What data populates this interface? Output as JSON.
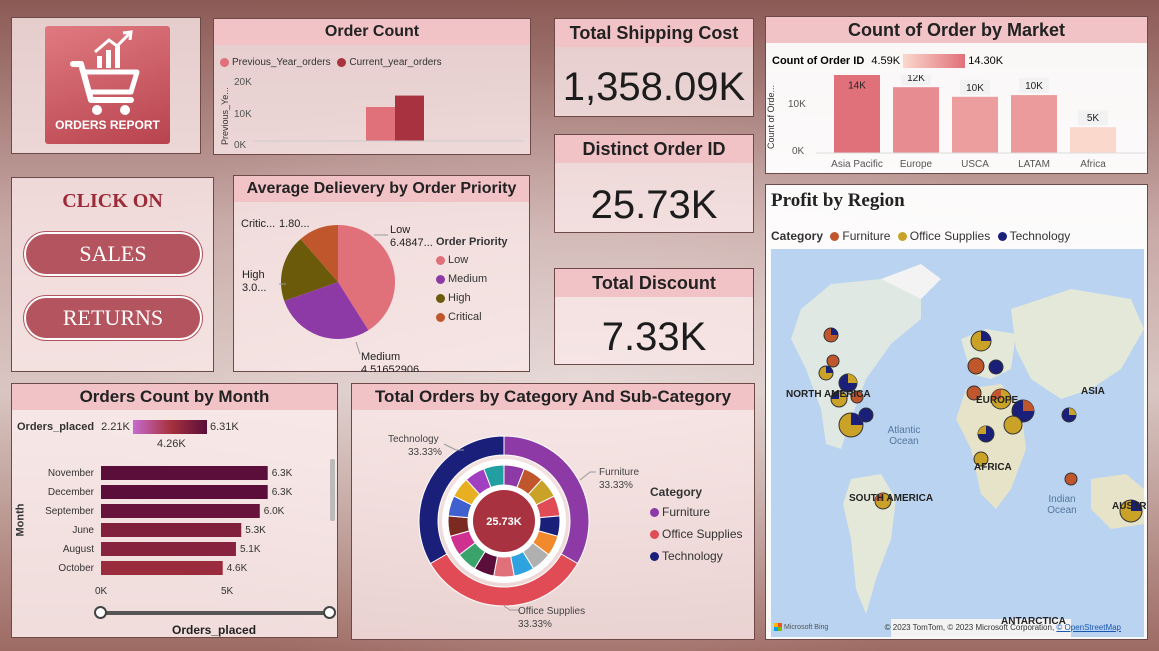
{
  "logo": {
    "label": "ORDERS REPORT"
  },
  "nav": {
    "title": "CLICK ON",
    "sales": "SALES",
    "returns": "RETURNS"
  },
  "order_count": {
    "title": "Order Count",
    "legend": [
      "Previous_Year_orders",
      "Current_year_orders"
    ],
    "ylabel": "Previous_Ye...",
    "ticks": [
      "20K",
      "10K",
      "0K"
    ],
    "colors": [
      "#e0707a",
      "#a8323f"
    ]
  },
  "shipping": {
    "title": "Total Shipping Cost",
    "value": "1,358.09K"
  },
  "distinct": {
    "title": "Distinct Order ID",
    "value": "25.73K"
  },
  "discount": {
    "title": "Total Discount",
    "value": "7.33K"
  },
  "market": {
    "title": "Count of Order by Market",
    "gradient_label": "Count of Order ID",
    "gradient_min": "4.59K",
    "gradient_max": "14.30K",
    "ylabel": "Count of Orde...",
    "ticks": [
      "10K",
      "0K"
    ]
  },
  "priority": {
    "title": "Average Delievery by Order Priority",
    "legend_title": "Order Priority",
    "labels": [
      {
        "name": "Low",
        "text1": "Low",
        "text2": "6.4847..."
      },
      {
        "name": "Medium",
        "text1": "Medium",
        "text2": "4.51652906..."
      },
      {
        "name": "High",
        "text1": "High",
        "text2": "3.0..."
      },
      {
        "name": "Critical",
        "text1": "Critic...",
        "text2": "1.80..."
      }
    ],
    "legend": [
      "Low",
      "Medium",
      "High",
      "Critical"
    ],
    "colors": [
      "#e0707a",
      "#8e3aa6",
      "#6b5a0a",
      "#c0562c"
    ]
  },
  "region": {
    "title": "Profit by Region",
    "legend_title": "Category",
    "legend": [
      "Furniture",
      "Office Supplies",
      "Technology"
    ],
    "colors": [
      "#c0562c",
      "#c9a227",
      "#1a1f7a"
    ],
    "labels": {
      "na": "NORTH AMERICA",
      "sa": "SOUTH AMERICA",
      "asia": "ASIA",
      "europe": "EUROPE",
      "africa": "AFRICA",
      "aus": "AUSTR",
      "antarctica": "ANTARCTICA",
      "atlantic": "Atlantic Ocean",
      "indian": "Indian Ocean"
    },
    "attrib": "© 2023 TomTom, © 2023 Microsoft Corporation,",
    "attrib_link": "© OpenStreetMap",
    "bing": "Microsoft Bing"
  },
  "month": {
    "title": "Orders Count by Month",
    "gradient_label": "Orders_placed",
    "gradient_min": "2.21K",
    "gradient_mid": "4.26K",
    "gradient_max": "6.31K",
    "ylabel": "Month",
    "xlabel": "Orders_placed",
    "xticks": [
      "0K",
      "5K"
    ]
  },
  "category": {
    "title": "Total Orders by Category And Sub-Category",
    "center": "25.73K",
    "legend_title": "Category",
    "legend": [
      "Furniture",
      "Office Supplies",
      "Technology"
    ],
    "colors": [
      "#8e3aa6",
      "#e04b55",
      "#1a1f7a"
    ],
    "outer_labels": [
      {
        "name": "Technology",
        "pct": "33.33%"
      },
      {
        "name": "Furniture",
        "pct": "33.33%"
      },
      {
        "name": "Office Supplies",
        "pct": "33.33%"
      }
    ]
  },
  "chart_data": [
    {
      "type": "bar",
      "title": "Order Count",
      "categories": [
        ""
      ],
      "series": [
        {
          "name": "Previous_Year_orders",
          "values": [
            12500
          ]
        },
        {
          "name": "Current_year_orders",
          "values": [
            16700
          ]
        }
      ],
      "ylim": [
        0,
        25000
      ]
    },
    {
      "type": "bar",
      "title": "Count of Order by Market",
      "categories": [
        "Asia Pacific",
        "Europe",
        "USCA",
        "LATAM",
        "Africa"
      ],
      "values": [
        14300,
        11700,
        9994,
        10294,
        4587
      ],
      "data_labels": [
        "14K",
        "12K",
        "10K",
        "10K",
        "5K"
      ],
      "ylim": [
        0,
        16000
      ]
    },
    {
      "type": "pie",
      "title": "Average Delievery by Order Priority",
      "categories": [
        "Low",
        "Medium",
        "High",
        "Critical"
      ],
      "values": [
        6.4847,
        4.5165,
        3.0,
        1.8
      ]
    },
    {
      "type": "bar",
      "title": "Orders Count by Month",
      "orientation": "horizontal",
      "categories": [
        "November",
        "December",
        "September",
        "June",
        "August",
        "October"
      ],
      "values": [
        6300,
        6300,
        6000,
        5300,
        5100,
        4600
      ],
      "data_labels": [
        "6.3K",
        "6.3K",
        "6.0K",
        "5.3K",
        "5.1K",
        "4.6K"
      ],
      "xlim": [
        0,
        6800
      ]
    },
    {
      "type": "pie",
      "title": "Total Orders by Category And Sub-Category",
      "categories": [
        "Furniture",
        "Office Supplies",
        "Technology"
      ],
      "values": [
        33.33,
        33.33,
        33.33
      ]
    }
  ]
}
